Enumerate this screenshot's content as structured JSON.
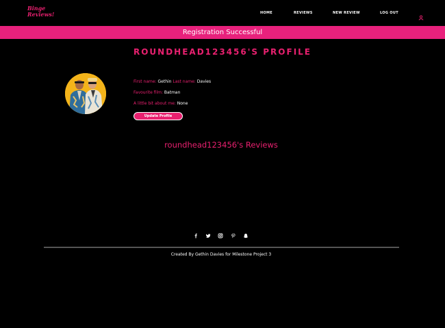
{
  "brand": {
    "line1": "Binge",
    "line2": "Reviews!"
  },
  "nav": {
    "home": "HOME",
    "reviews": "REVIEWS",
    "new_review": "NEW REVIEW",
    "logout": "LOG OUT"
  },
  "flash": "Registration Successful",
  "profile": {
    "title": "ROUNDHEAD123456'S PROFILE",
    "first_name_label": "First name:",
    "first_name": "Gethin",
    "last_name_label": "Last name:",
    "last_name": "Davies",
    "favourite_film_label": "Favourite film:",
    "favourite_film": "Batman",
    "about_label": "A little bit about me:",
    "about": "None",
    "update_button": "Update Profile"
  },
  "reviews_title": "roundhead123456's Reviews",
  "footer": {
    "social": [
      "facebook-icon",
      "twitter-icon",
      "instagram-icon",
      "pinterest-icon",
      "snapchat-icon"
    ],
    "credit": "Created By Gethin Davies for Milestone Project 3"
  },
  "colors": {
    "accent": "#e8206f",
    "flash": "#e8217c",
    "background": "#000000"
  }
}
